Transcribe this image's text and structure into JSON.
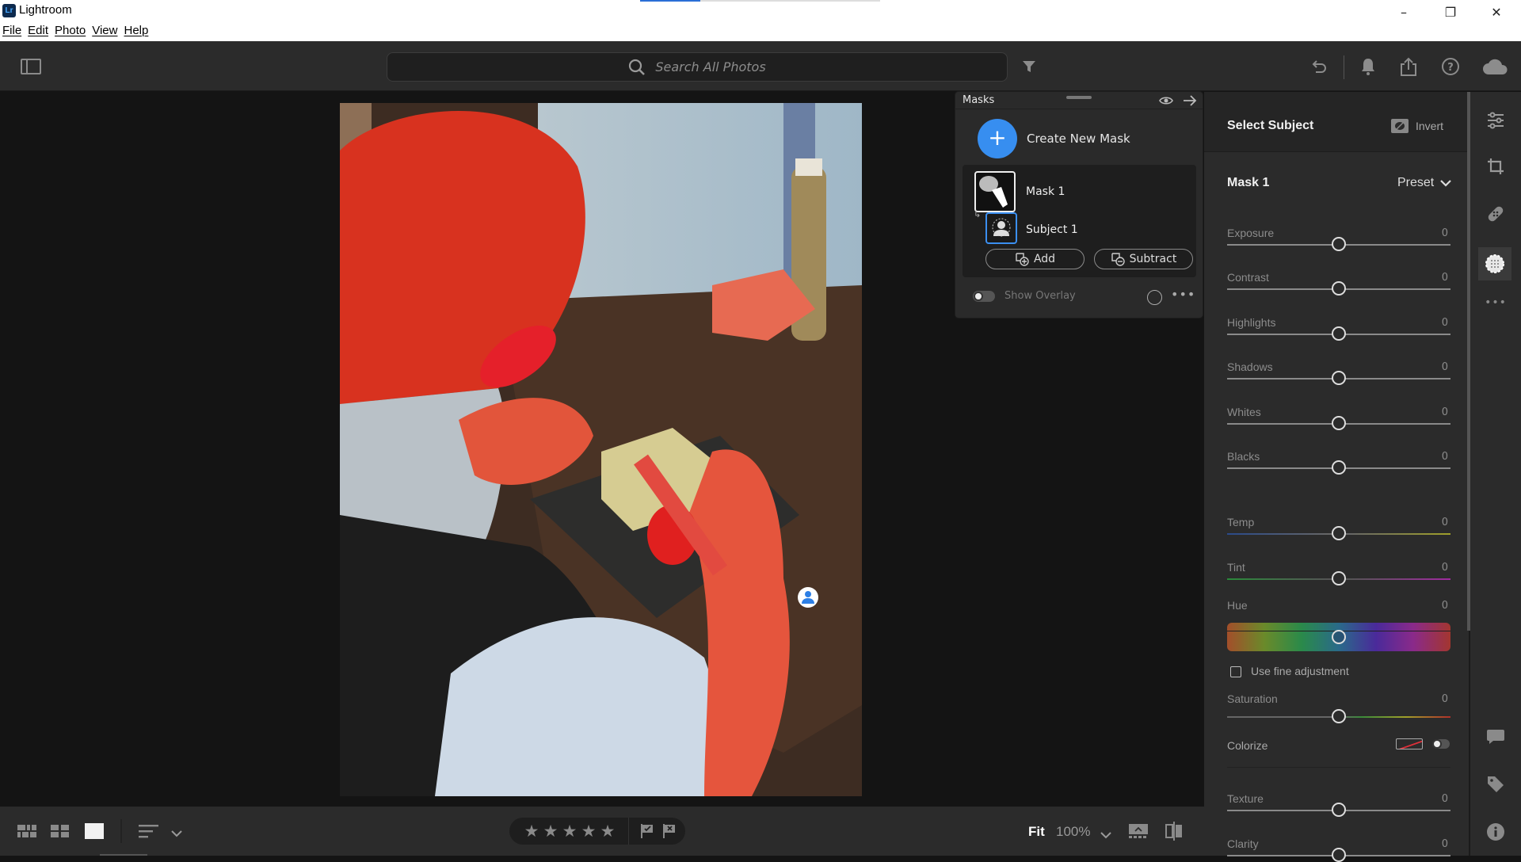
{
  "window": {
    "app_name": "Lightroom",
    "logo_text": "Lr",
    "menu": [
      "File",
      "Edit",
      "Photo",
      "View",
      "Help"
    ],
    "controls": {
      "minimize": "–",
      "restore": "❐",
      "close": "✕"
    },
    "load_progress": 0.25
  },
  "toolbar": {
    "search_placeholder": "Search All Photos",
    "icons": [
      "panel-toggle-icon",
      "search-icon",
      "filter-icon",
      "undo-icon",
      "notifications-icon",
      "share-icon",
      "help-icon",
      "cloud-icon"
    ]
  },
  "masks_panel": {
    "title": "Masks",
    "create_label": "Create New Mask",
    "masks": [
      {
        "name": "Mask 1",
        "components": [
          {
            "name": "Subject 1",
            "type": "subject"
          }
        ]
      }
    ],
    "add_label": "Add",
    "subtract_label": "Subtract",
    "overlay_label": "Show Overlay",
    "overlay_on": false
  },
  "right_panel": {
    "header": "Select Subject",
    "invert_label": "Invert",
    "mask_name": "Mask 1",
    "preset_label": "Preset",
    "sliders_light": [
      {
        "label": "Exposure",
        "value": "0"
      },
      {
        "label": "Contrast",
        "value": "0"
      },
      {
        "label": "Highlights",
        "value": "0"
      },
      {
        "label": "Shadows",
        "value": "0"
      },
      {
        "label": "Whites",
        "value": "0"
      },
      {
        "label": "Blacks",
        "value": "0"
      }
    ],
    "sliders_color": [
      {
        "label": "Temp",
        "value": "0"
      },
      {
        "label": "Tint",
        "value": "0"
      },
      {
        "label": "Hue",
        "value": "0"
      }
    ],
    "fine_adjust_label": "Use fine adjustment",
    "saturation": {
      "label": "Saturation",
      "value": "0"
    },
    "colorize_label": "Colorize",
    "sliders_effects": [
      {
        "label": "Texture",
        "value": "0"
      },
      {
        "label": "Clarity",
        "value": "0"
      }
    ]
  },
  "bottom_bar": {
    "fit_label": "Fit",
    "zoom_label": "100%",
    "stars": [
      "★",
      "★",
      "★",
      "★",
      "★"
    ],
    "rating": 0
  }
}
